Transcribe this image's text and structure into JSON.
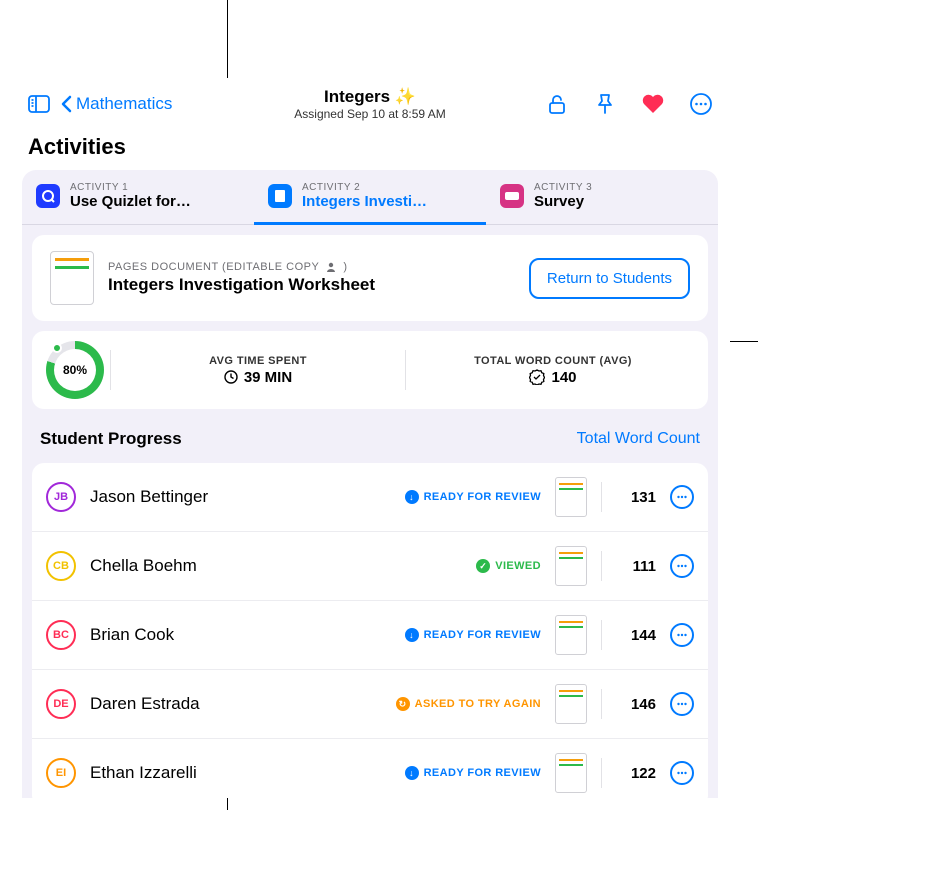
{
  "header": {
    "back_label": "Mathematics",
    "title": "Integers ✨",
    "subtitle": "Assigned Sep 10 at 8:59 AM"
  },
  "section_heading": "Activities",
  "tabs": [
    {
      "kicker": "ACTIVITY 1",
      "label": "Use Quizlet for…",
      "icon": "quizlet-icon",
      "active": false
    },
    {
      "kicker": "ACTIVITY 2",
      "label": "Integers Investi…",
      "icon": "pages-icon",
      "active": true
    },
    {
      "kicker": "ACTIVITY 3",
      "label": "Survey",
      "icon": "survey-icon",
      "active": false
    }
  ],
  "detail": {
    "kicker": "PAGES DOCUMENT (EDITABLE COPY",
    "kicker_icon_hint": "person-icon",
    "kicker_close": ")",
    "title": "Integers Investigation Worksheet",
    "return_button": "Return to Students"
  },
  "metrics": {
    "progress_percent": "80%",
    "avg_time_label": "AVG TIME SPENT",
    "avg_time_value": "39 MIN",
    "word_count_label": "TOTAL WORD COUNT (AVG)",
    "word_count_value": "140"
  },
  "progress": {
    "title": "Student Progress",
    "sort_label": "Total Word Count"
  },
  "status_labels": {
    "review": "READY FOR REVIEW",
    "viewed": "VIEWED",
    "retry": "ASKED TO TRY AGAIN"
  },
  "students": [
    {
      "initials": "JB",
      "color": "#a128d9",
      "name": "Jason Bettinger",
      "status": "review",
      "count": "131"
    },
    {
      "initials": "CB",
      "color": "#f2c200",
      "name": "Chella Boehm",
      "status": "viewed",
      "count": "111"
    },
    {
      "initials": "BC",
      "color": "#ff2d55",
      "name": "Brian Cook",
      "status": "review",
      "count": "144"
    },
    {
      "initials": "DE",
      "color": "#ff2d55",
      "name": "Daren Estrada",
      "status": "retry",
      "count": "146"
    },
    {
      "initials": "EI",
      "color": "#ff9500",
      "name": "Ethan Izzarelli",
      "status": "review",
      "count": "122"
    }
  ]
}
